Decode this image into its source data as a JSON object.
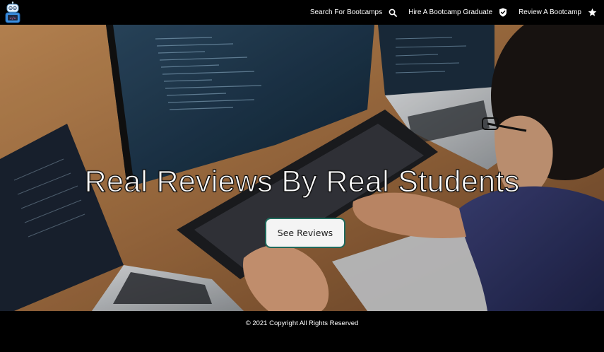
{
  "navbar": {
    "logo_icon": "robot-coder-logo",
    "links": [
      {
        "label": "Search For Bootcamps",
        "icon": "search-icon"
      },
      {
        "label": "Hire A Bootcamp Graduate",
        "icon": "shield-check-icon"
      },
      {
        "label": "Review A Bootcamp",
        "icon": "star-icon"
      }
    ]
  },
  "hero": {
    "title": "Real Reviews By Real Students",
    "button_label": "See Reviews",
    "button_border_color": "#1f6a5c"
  },
  "footer": {
    "copyright": "© 2021 Copyright All Rights Reserved"
  },
  "colors": {
    "navbar_bg": "#000000",
    "footer_bg": "#000000",
    "text": "#ffffff"
  }
}
